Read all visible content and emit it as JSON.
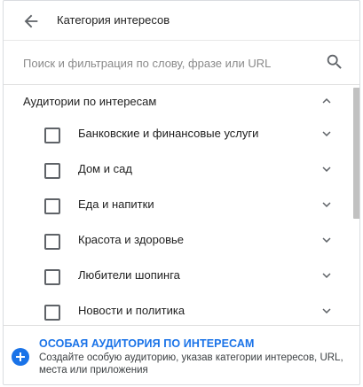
{
  "header": {
    "title": "Категория интересов",
    "back_icon": "arrow-back-icon"
  },
  "search": {
    "placeholder": "Поиск и фильтрация по слову, фразе или URL",
    "value": "",
    "icon": "search-icon"
  },
  "group": {
    "label": "Аудитории по интересам",
    "expanded": true,
    "icon": "chevron-up-icon"
  },
  "items": [
    {
      "label": "Банковские и финансовые услуги",
      "checked": false
    },
    {
      "label": "Дом и сад",
      "checked": false
    },
    {
      "label": "Еда и напитки",
      "checked": false
    },
    {
      "label": "Красота и здоровье",
      "checked": false
    },
    {
      "label": "Любители шопинга",
      "checked": false
    },
    {
      "label": "Новости и политика",
      "checked": false
    }
  ],
  "footer": {
    "title": "ОСОБАЯ АУДИТОРИЯ ПО ИНТЕРЕСАМ",
    "description": "Создайте особую аудиторию, указав категории интересов, URL, места или приложения",
    "icon": "plus-circle-icon"
  },
  "colors": {
    "accent": "#1a73e8",
    "text": "#212121",
    "muted": "#8a8a8a",
    "icon": "#5f6368",
    "scroll_thumb": "#c1c1c1"
  }
}
